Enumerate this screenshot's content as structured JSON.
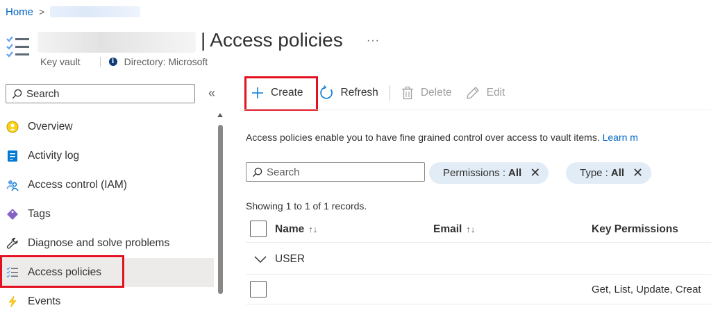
{
  "breadcrumb": {
    "home": "Home",
    "separator": ">"
  },
  "header": {
    "title_separator": "|",
    "title": "Access policies",
    "more": "···",
    "resource_type": "Key vault",
    "directory": "Directory: Microsoft",
    "info_glyph": "i"
  },
  "nav": {
    "search_placeholder": "Search",
    "collapse": "«",
    "items": [
      {
        "label": "Overview",
        "icon": "overview-icon"
      },
      {
        "label": "Activity log",
        "icon": "activity-log-icon"
      },
      {
        "label": "Access control (IAM)",
        "icon": "iam-icon"
      },
      {
        "label": "Tags",
        "icon": "tag-icon"
      },
      {
        "label": "Diagnose and solve problems",
        "icon": "wrench-icon"
      },
      {
        "label": "Access policies",
        "icon": "access-policies-icon",
        "selected": true
      },
      {
        "label": "Events",
        "icon": "lightning-icon"
      }
    ]
  },
  "toolbar": {
    "create": "Create",
    "refresh": "Refresh",
    "delete": "Delete",
    "edit": "Edit"
  },
  "description": {
    "text": "Access policies enable you to have fine grained control over access to vault items. ",
    "link": "Learn m"
  },
  "filters": {
    "search_placeholder": "Search",
    "permissions_label": "Permissions :",
    "permissions_value": "All",
    "type_label": "Type :",
    "type_value": "All",
    "remove": "✕"
  },
  "records": "Showing 1 to 1 of 1 records.",
  "table": {
    "columns": [
      "Name",
      "Email",
      "Key Permissions"
    ],
    "sort_glyph": "↑↓",
    "group": "USER",
    "rows": [
      {
        "name": "",
        "email": "",
        "key_permissions": "Get, List, Update, Creat"
      }
    ]
  },
  "colors": {
    "accent": "#0078d4",
    "link": "#0066c4",
    "highlight_border": "#e3101f",
    "pill_bg": "#e1ecf7"
  }
}
